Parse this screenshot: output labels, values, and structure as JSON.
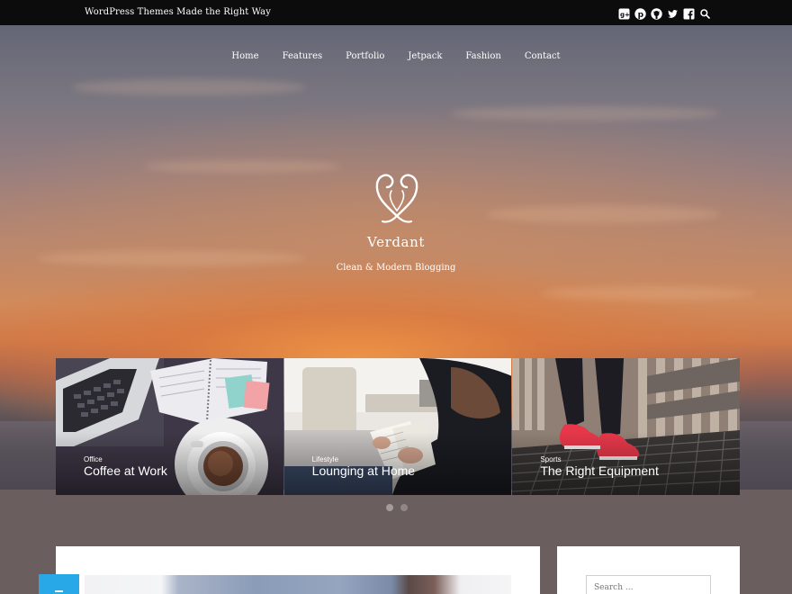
{
  "topbar": {
    "tagline": "WordPress Themes Made the Right Way",
    "social_icons": [
      "google-plus-icon",
      "pinterest-icon",
      "github-icon",
      "twitter-icon",
      "facebook-icon",
      "search-icon"
    ]
  },
  "nav": {
    "items": [
      "Home",
      "Features",
      "Portfolio",
      "Jetpack",
      "Fashion",
      "Contact"
    ]
  },
  "site": {
    "title": "Verdant",
    "description": "Clean & Modern Blogging"
  },
  "slider": {
    "slides": [
      {
        "category": "Office",
        "title": "Coffee at Work"
      },
      {
        "category": "Lifestyle",
        "title": "Lounging at Home"
      },
      {
        "category": "Sports",
        "title": "The Right Equipment"
      }
    ],
    "active_index": 0,
    "dot_count": 2
  },
  "sidebar": {
    "search_placeholder": "Search ..."
  },
  "colors": {
    "topbar_bg": "#0c0c0c",
    "page_bg": "#6b5e5e",
    "accent": "#29a8e8"
  }
}
